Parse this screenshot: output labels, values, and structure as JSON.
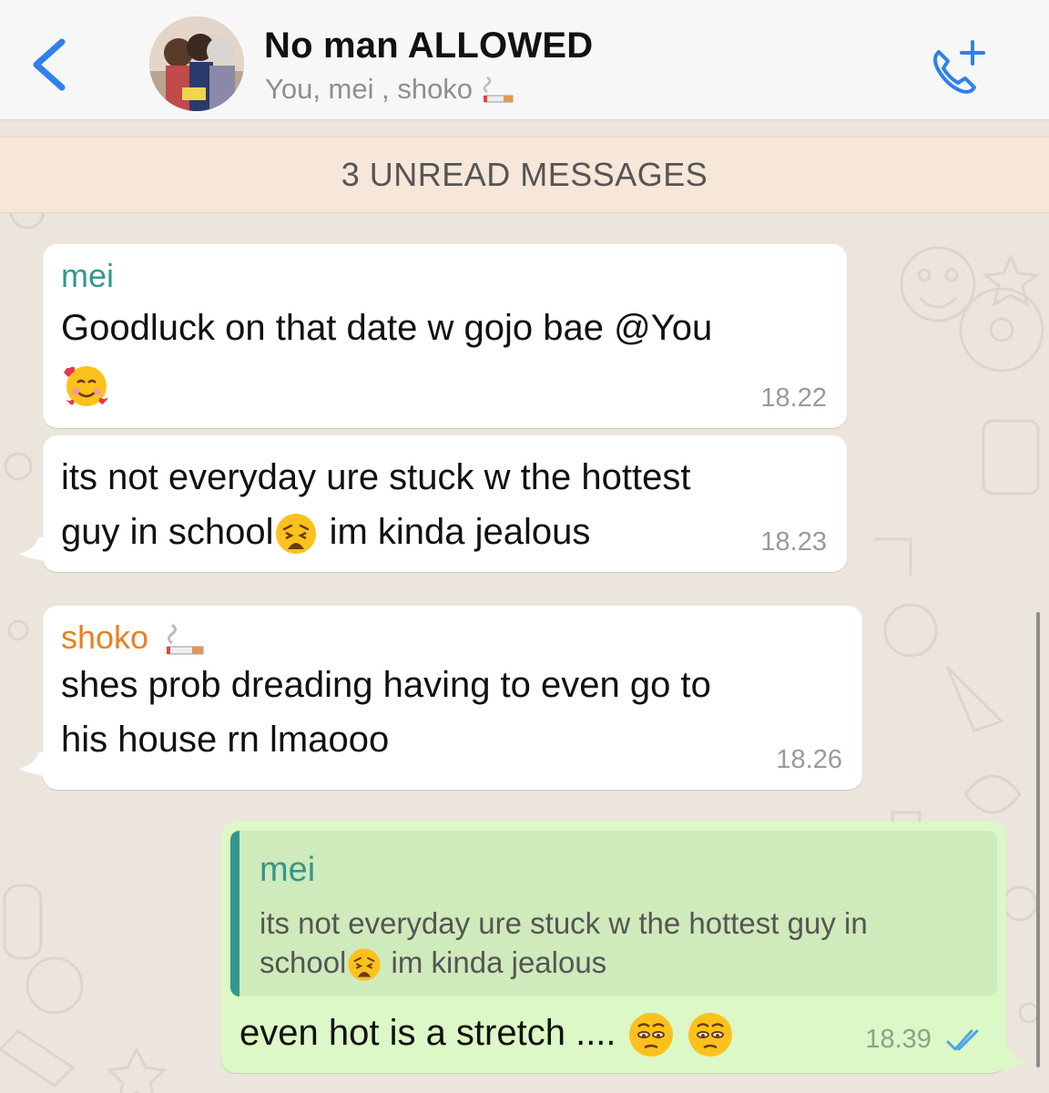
{
  "header": {
    "title": "No man ALLOWED",
    "subtitle": "You, mei , shoko",
    "back_icon": "chevron-left-icon",
    "call_icon": "add-call-icon",
    "accent": "#2f80ed"
  },
  "banner": {
    "unread": "3 UNREAD MESSAGES"
  },
  "messages": [
    {
      "sender": "mei",
      "sender_color": "#35978c",
      "line1": "Goodluck on that date w gojo bae @You",
      "emoji": "smiling-face-with-hearts",
      "time": "18.22"
    },
    {
      "line1": "its not everyday ure stuck w the hottest",
      "line2a": "guy in school",
      "emoji": "weary-face",
      "line2b": " im kinda jealous",
      "time": "18.23"
    },
    {
      "sender": "shoko",
      "sender_color": "#e8821e",
      "sender_emoji": "cigarette",
      "line1": "shes prob dreading having to even go to",
      "line2": "his house rn lmaooo",
      "time": "18.26"
    },
    {
      "quote_sender": "mei",
      "quote_line1": "its not everyday ure stuck w the hottest guy in",
      "quote_line2a": "school",
      "quote_emoji": "weary-face",
      "quote_line2b": " im kinda jealous",
      "text": "even hot is a stretch ....",
      "emojis": [
        "pleading-face",
        "pleading-face"
      ],
      "time": "18.39",
      "status_icon": "double-check-read-icon"
    }
  ]
}
